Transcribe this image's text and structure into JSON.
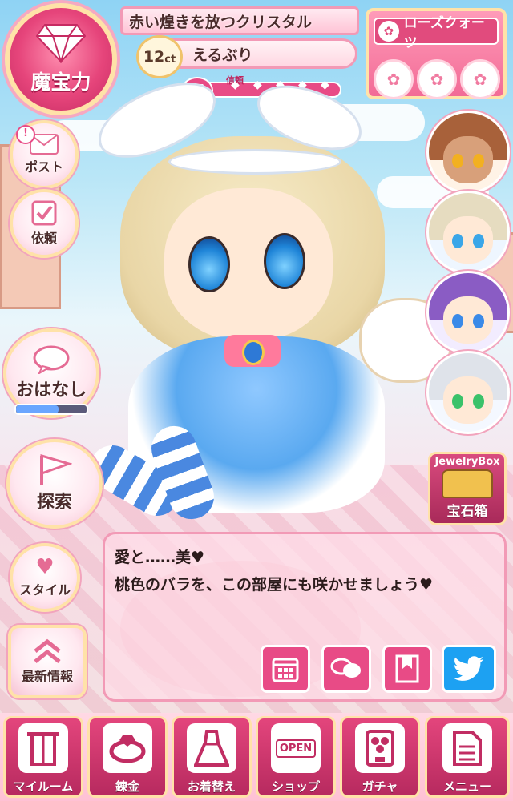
{
  "status": {
    "magic_power_label": "魔宝力",
    "jewel_name": "赤い煌きを放つクリスタル",
    "carat": "12",
    "carat_unit": "ct",
    "character_name": "えるぶり",
    "trust_label": "信頼",
    "trust_level": 5,
    "trust_max": 5
  },
  "rose_panel": {
    "title": "ローズクォーツ",
    "slots": 3
  },
  "left_menu": [
    {
      "label": "ポスト",
      "icon": "envelope-icon",
      "notification": "!"
    },
    {
      "label": "依頼",
      "icon": "checkbox-icon"
    },
    {
      "label": "おはなし",
      "icon": "speech-icon",
      "gauge": 0.6
    },
    {
      "label": "探索",
      "icon": "flag-icon"
    },
    {
      "label": "スタイル",
      "icon": "heart-icon"
    },
    {
      "label": "最新情報",
      "icon": "double-chevron-up-icon"
    }
  ],
  "right_panel": {
    "jewelry_box_top": "JewelryBox",
    "jewelry_box_label": "宝石箱"
  },
  "dialog": {
    "speaker": "愛と……美♥",
    "text": "桃色のバラを、この部屋にも咲かせましょう♥",
    "icons": [
      "calendar-icon",
      "chat-icon",
      "bookmark-icon",
      "twitter-icon"
    ]
  },
  "bottom_nav": [
    {
      "label": "マイルーム",
      "icon": "door-icon"
    },
    {
      "label": "錬金",
      "icon": "ring-icon"
    },
    {
      "label": "お着替え",
      "icon": "dress-icon"
    },
    {
      "label": "ショップ",
      "icon": "shop-sign-icon",
      "sign_text": "OPEN"
    },
    {
      "label": "ガチャ",
      "icon": "gacha-icon"
    },
    {
      "label": "メニュー",
      "icon": "document-icon"
    }
  ],
  "colors": {
    "accent": "#e3457c",
    "border": "#ffe2a8",
    "twitter": "#1da1f2"
  }
}
